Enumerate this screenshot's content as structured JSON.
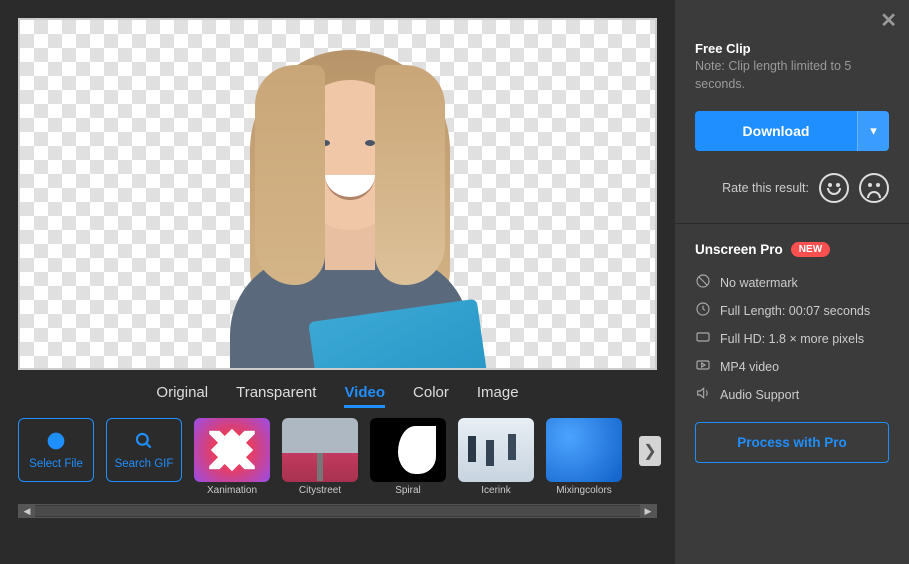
{
  "tabs": {
    "original": "Original",
    "transparent": "Transparent",
    "video": "Video",
    "color": "Color",
    "image": "Image",
    "active": "video"
  },
  "actions": {
    "select_file": "Select File",
    "search_gif": "Search GIF"
  },
  "thumbnails": [
    {
      "label": "Xanimation"
    },
    {
      "label": "Citystreet"
    },
    {
      "label": "Spiral"
    },
    {
      "label": "Icerink"
    },
    {
      "label": "Mixingcolors"
    }
  ],
  "sidebar": {
    "free_title": "Free Clip",
    "free_note": "Note: Clip length limited to 5 seconds.",
    "download_label": "Download",
    "rate_label": "Rate this result:",
    "pro_title": "Unscreen Pro",
    "new_badge": "NEW",
    "features": {
      "no_watermark": "No watermark",
      "full_length": "Full Length: 00:07 seconds",
      "full_hd": "Full HD: 1.8 × more pixels",
      "mp4": "MP4 video",
      "audio": "Audio Support"
    },
    "process_label": "Process with Pro"
  }
}
